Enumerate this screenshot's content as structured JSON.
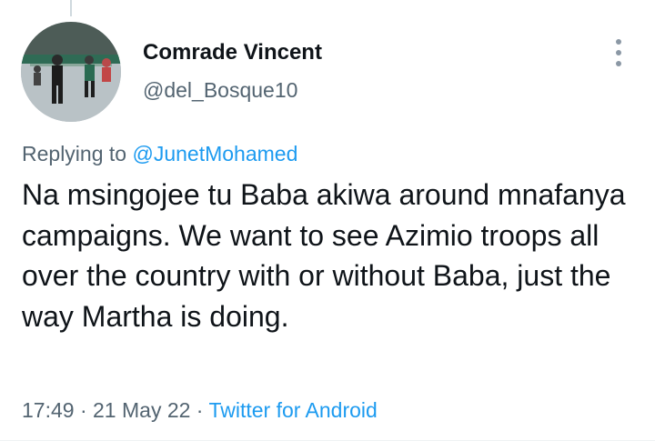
{
  "tweet": {
    "author_name": "Comrade Vincent",
    "author_handle": "@del_Bosque10",
    "replying_prefix": "Replying to ",
    "replying_mention": "@JunetMohamed",
    "text": "Na msingojee tu Baba akiwa around mnafanya campaigns. We want to see Azimio troops all over the country with or without Baba, just the way Martha is doing.",
    "time": "17:49",
    "separator": " · ",
    "date": "21 May 22",
    "source": "Twitter for Android"
  },
  "icons": {
    "more": "more-vertical-icon",
    "avatar": "profile-photo"
  },
  "colors": {
    "link": "#1d9bf0",
    "secondary_text": "#536471",
    "primary_text": "#0f1419"
  }
}
